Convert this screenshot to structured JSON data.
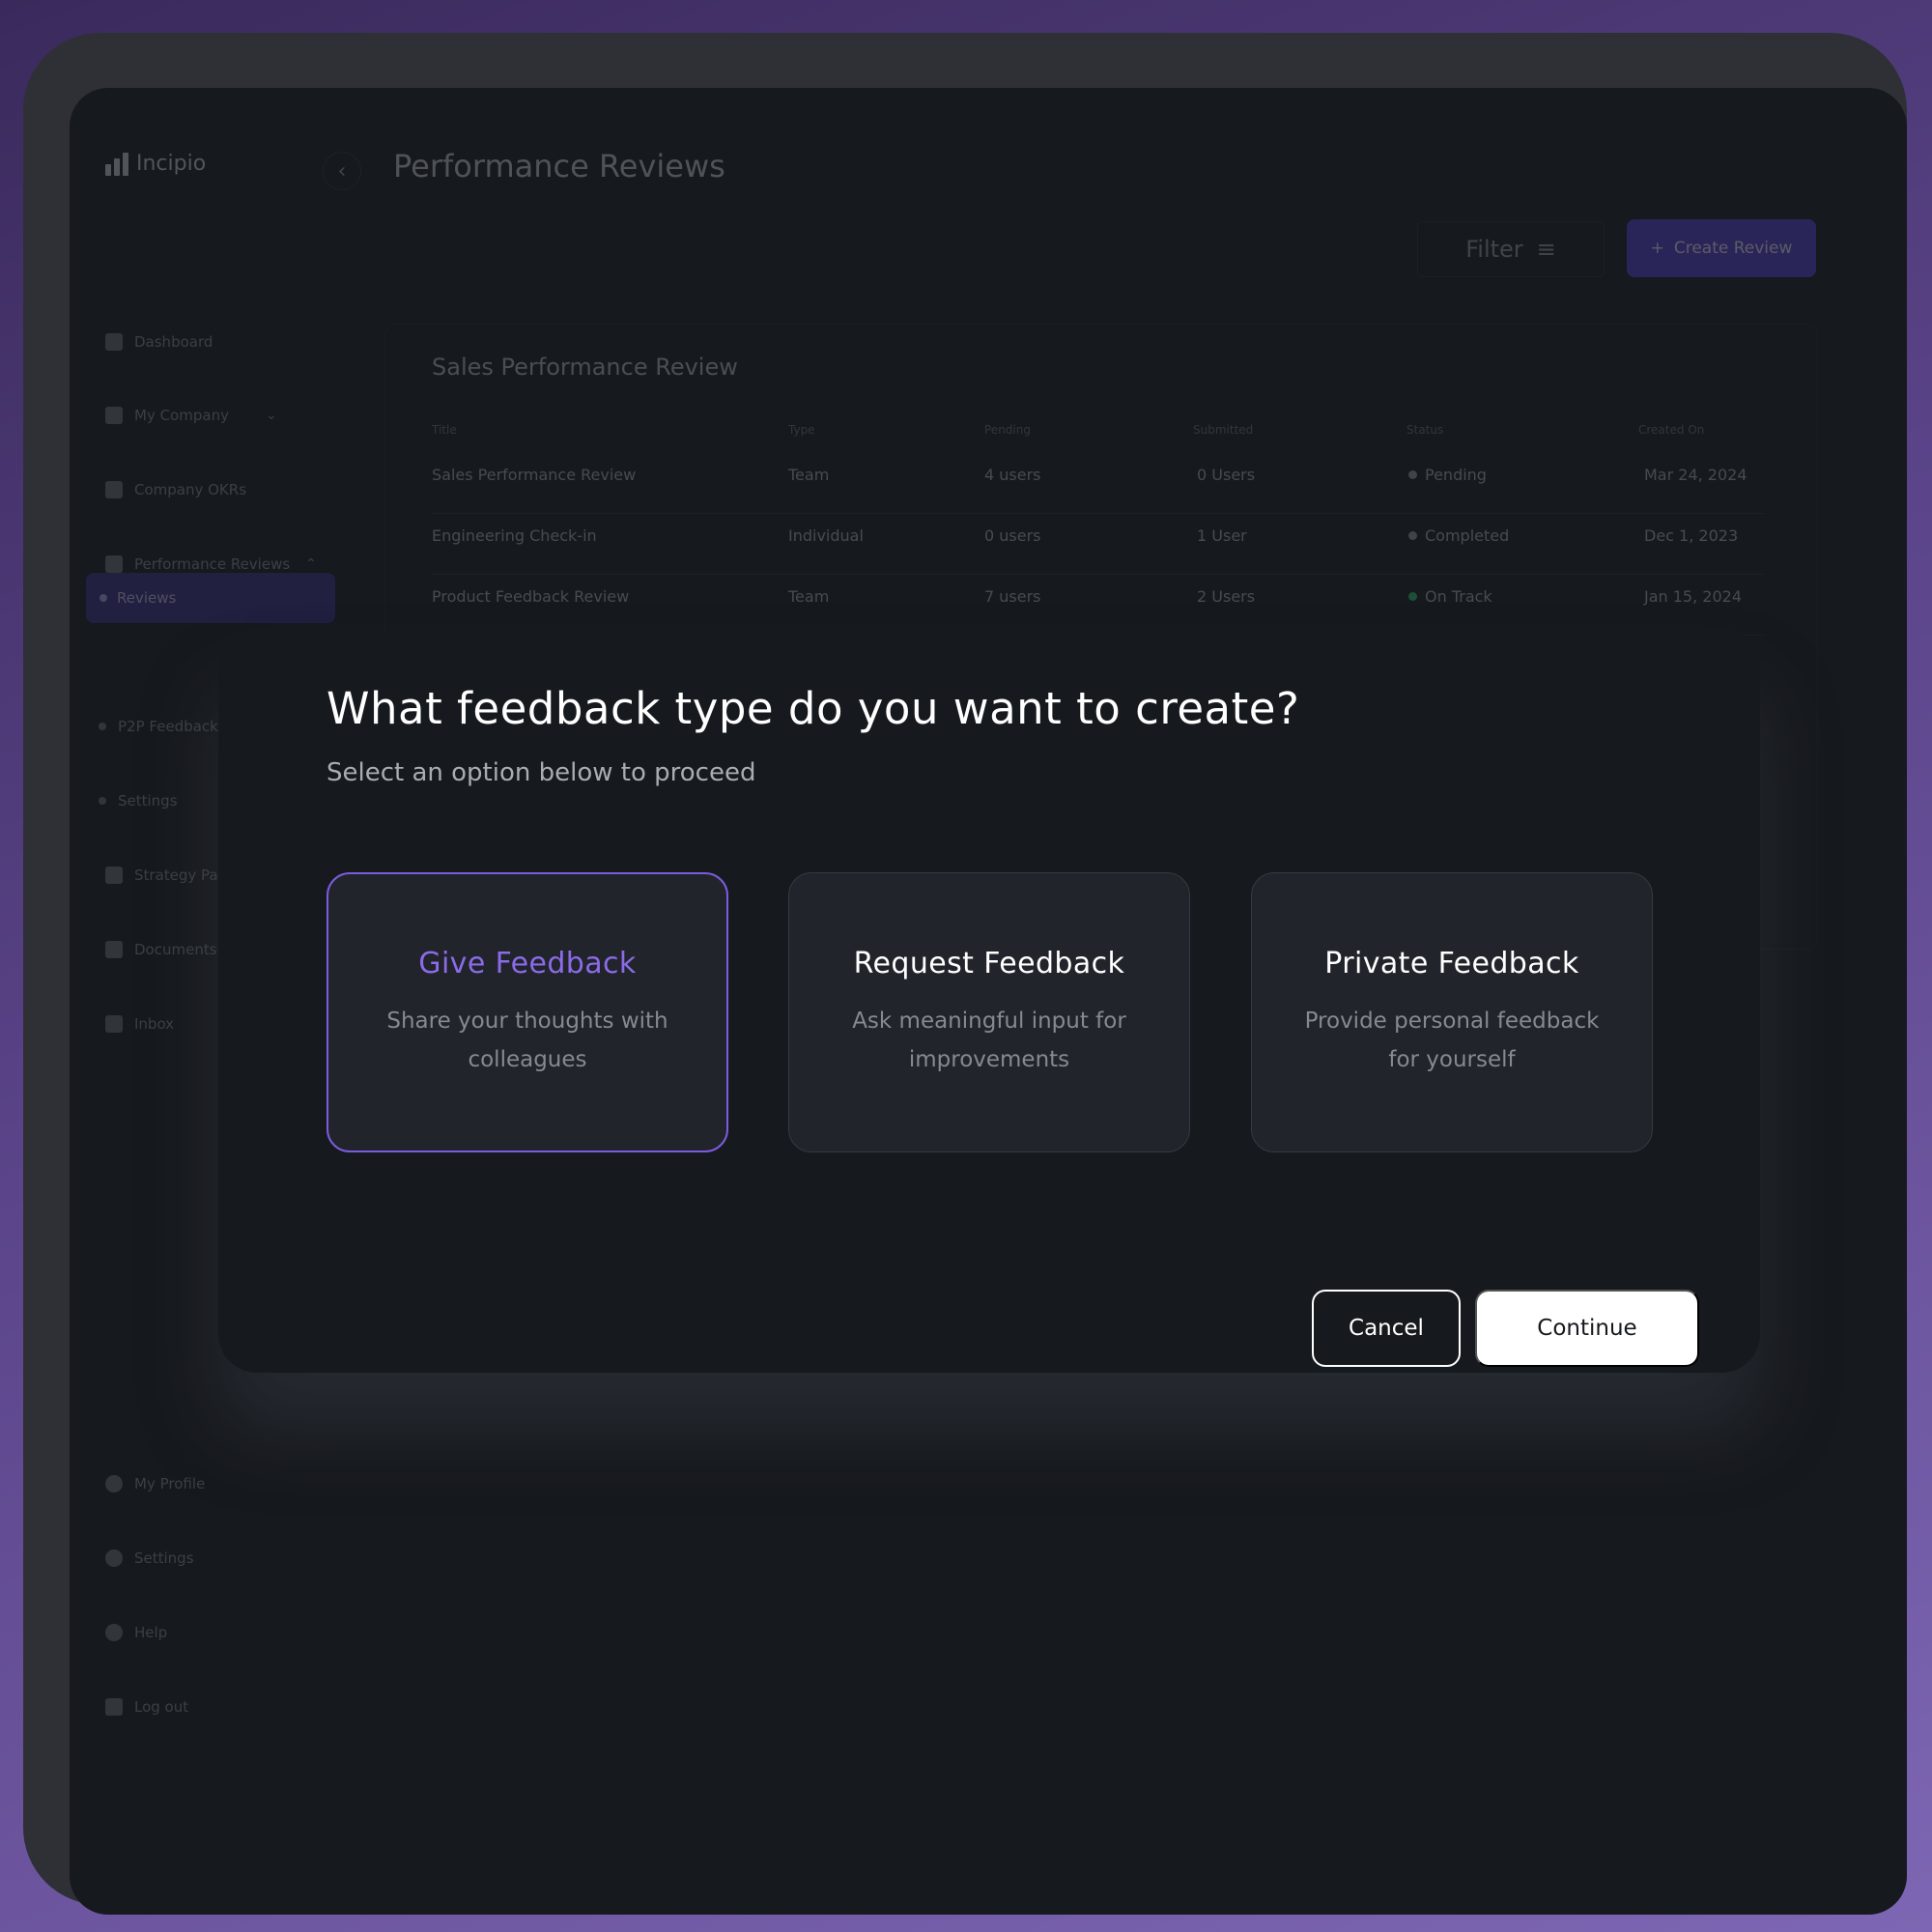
{
  "app": {
    "brand": "Incipio",
    "page_title": "Performance Reviews",
    "back_icon": "chevron-left-icon"
  },
  "sidebar": {
    "items": [
      {
        "label": "Dashboard",
        "icon": "dashboard-icon"
      },
      {
        "label": "My Company",
        "icon": "company-people-icon"
      },
      {
        "label": "Company OKRs",
        "icon": "building-icon"
      },
      {
        "label": "Performance Reviews",
        "icon": "bar-chart-icon"
      },
      {
        "label": "Reviews",
        "active": true
      },
      {
        "label": "P2P Feedback"
      },
      {
        "label": "Settings"
      },
      {
        "label": "Strategy Pa",
        "icon": "strategy-icon"
      },
      {
        "label": "Documents",
        "icon": "folder-icon"
      },
      {
        "label": "Inbox",
        "icon": "bell-icon"
      }
    ],
    "footer_items": [
      {
        "label": "My Profile",
        "icon": "user-icon"
      },
      {
        "label": "Settings",
        "icon": "gear-icon"
      },
      {
        "label": "Help",
        "icon": "help-icon"
      },
      {
        "label": "Log out",
        "icon": "logout-icon"
      }
    ]
  },
  "toolbar": {
    "filter_label": "Filter",
    "create_label": "Create Review"
  },
  "table": {
    "title": "Sales Performance Review",
    "columns": [
      "Title",
      "Type",
      "Pending",
      "Submitted",
      "Status",
      "Created On"
    ],
    "rows": [
      {
        "title": "Sales Performance Review",
        "type": "Team",
        "pending": "4 users",
        "submitted": "0 Users",
        "status": "Pending",
        "status_color": "#9aa0a8",
        "created": "Mar 24, 2024"
      },
      {
        "title": "Engineering Check-in",
        "type": "Individual",
        "pending": "0 users",
        "submitted": "1 User",
        "status": "Completed",
        "status_color": "#9aa0a8",
        "created": "Dec 1, 2023"
      },
      {
        "title": "Product Feedback Review",
        "type": "Team",
        "pending": "7 users",
        "submitted": "2 Users",
        "status": "On Track",
        "status_color": "#2fbf71",
        "created": "Jan 15, 2024"
      }
    ]
  },
  "modal": {
    "title": "What feedback type do you want to create?",
    "subtitle": "Select an option below to proceed",
    "options": [
      {
        "title": "Give Feedback",
        "description": "Share your thoughts with colleagues",
        "selected": true
      },
      {
        "title": "Request Feedback",
        "description": "Ask meaningful input for improvements",
        "selected": false
      },
      {
        "title": "Private Feedback",
        "description": "Provide personal feedback for yourself",
        "selected": false
      }
    ],
    "cancel_label": "Cancel",
    "continue_label": "Continue"
  },
  "colors": {
    "accent": "#7c5cde",
    "primary_button": "#5440d6"
  }
}
